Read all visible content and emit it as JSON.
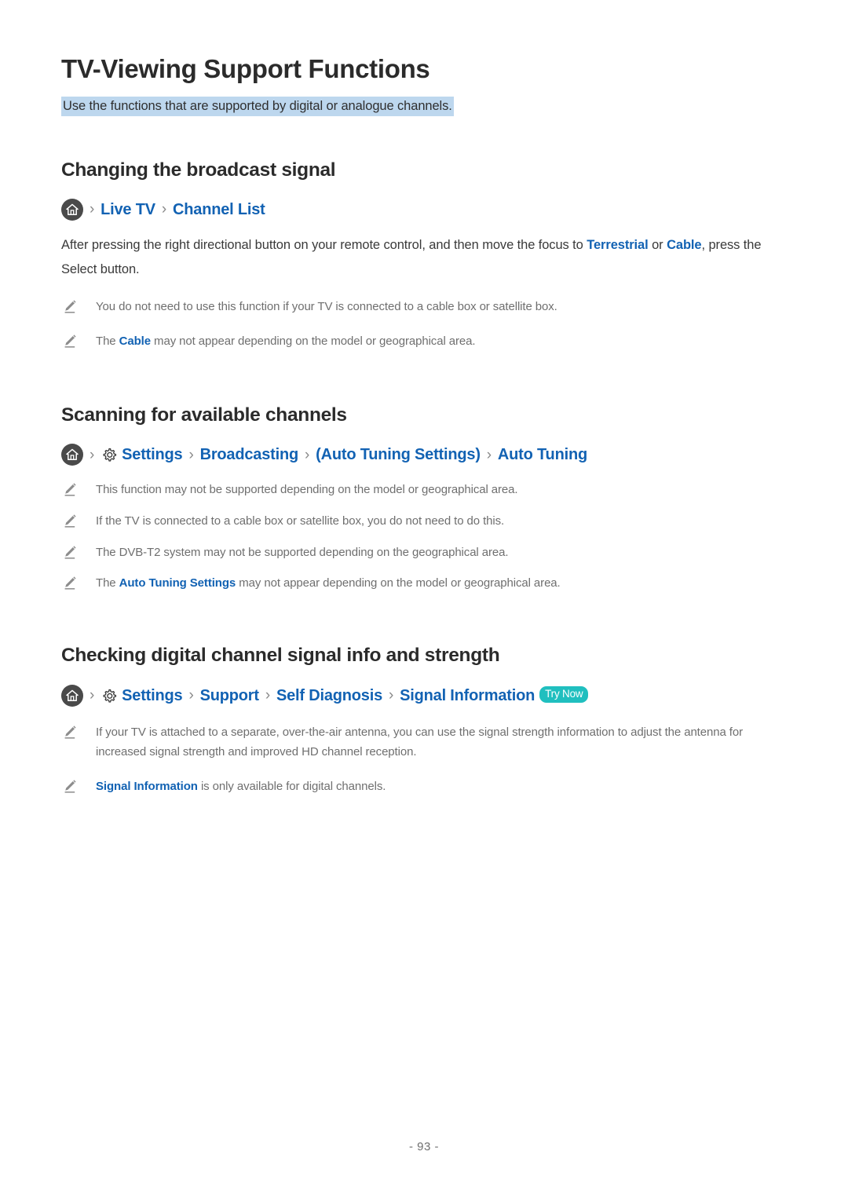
{
  "document": {
    "title": "TV-Viewing Support Functions",
    "subtitle": "Use the functions that are supported by digital or analogue channels.",
    "page_number": "- 93 -"
  },
  "colors": {
    "link_blue": "#1262B3",
    "highlight_blue": "#bdd7ee",
    "try_now_teal": "#20bfbf",
    "note_gray": "#6f6f6f",
    "heading_dark": "#2b2b2b"
  },
  "sections": [
    {
      "heading": "Changing the broadcast signal",
      "breadcrumb": {
        "home_icon": "home-icon",
        "separator": "›",
        "items": [
          {
            "label": "Live TV"
          },
          {
            "label": "Channel List"
          }
        ]
      },
      "paragraph": {
        "part1": "After pressing the right directional button on your remote control, and then move the focus to ",
        "link1": "Terrestrial",
        "part2": " or ",
        "link2": "Cable",
        "part3": ", press the Select button."
      },
      "notes": [
        {
          "icon": "pencil-icon",
          "part1": "You do not need to use this function if your TV is connected to a cable box or satellite box.",
          "link": "",
          "part2": ""
        },
        {
          "icon": "pencil-icon",
          "part1": "The ",
          "link": "Cable",
          "part2": " may not appear depending on the model or geographical area."
        }
      ]
    },
    {
      "heading": "Scanning for available channels",
      "breadcrumb": {
        "home_icon": "home-icon",
        "separator": "›",
        "gear_icon": "gear-icon",
        "items": [
          {
            "label": "Settings"
          },
          {
            "label": "Broadcasting"
          },
          {
            "label": "Auto Tuning Settings",
            "parenthesized": true
          },
          {
            "label": "Auto Tuning"
          }
        ]
      },
      "notes": [
        {
          "icon": "pencil-icon",
          "part1": "This function may not be supported depending on the model or geographical area.",
          "link": "",
          "part2": ""
        },
        {
          "icon": "pencil-icon",
          "part1": "If the TV is connected to a cable box or satellite box, you do not need to do this.",
          "link": "",
          "part2": ""
        },
        {
          "icon": "pencil-icon",
          "part1": "The DVB-T2 system may not be supported depending on the geographical area.",
          "link": "",
          "part2": ""
        },
        {
          "icon": "pencil-icon",
          "part1": "The ",
          "link": "Auto Tuning Settings",
          "part2": " may not appear depending on the model or geographical area."
        }
      ]
    },
    {
      "heading": "Checking digital channel signal info and strength",
      "breadcrumb": {
        "home_icon": "home-icon",
        "separator": "›",
        "gear_icon": "gear-icon",
        "items": [
          {
            "label": "Settings"
          },
          {
            "label": "Support"
          },
          {
            "label": "Self Diagnosis"
          },
          {
            "label": "Signal Information"
          }
        ],
        "badge": "Try Now"
      },
      "notes": [
        {
          "icon": "pencil-icon",
          "part1": "If your TV is attached to a separate, over-the-air antenna, you can use the signal strength information to adjust the antenna for increased signal strength and improved HD channel reception.",
          "link": "",
          "part2": ""
        },
        {
          "icon": "pencil-icon",
          "part1": "",
          "link": "Signal Information",
          "part2": " is only available for digital channels."
        }
      ]
    }
  ]
}
